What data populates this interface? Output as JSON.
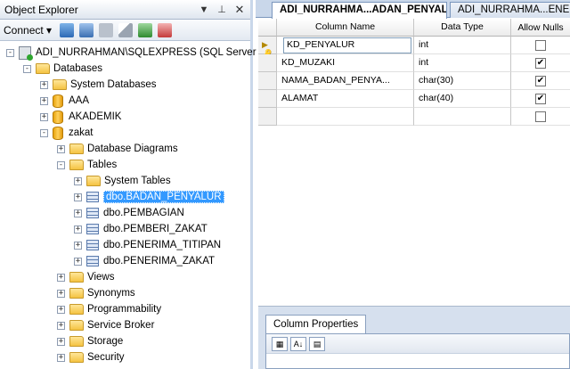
{
  "explorer": {
    "title": "Object Explorer",
    "pin_glyph": "▼",
    "autohide_glyph": "⊥",
    "close_glyph": "✕",
    "connect_label": "Connect ▾",
    "tree": [
      {
        "label": "ADI_NURRAHMAN\\SQLEXPRESS (SQL Server",
        "indent": 0,
        "exp": "-",
        "icon": "server-icon"
      },
      {
        "label": "Databases",
        "indent": 1,
        "exp": "-",
        "icon": "folder-icon"
      },
      {
        "label": "System Databases",
        "indent": 2,
        "exp": "+",
        "icon": "folder-icon"
      },
      {
        "label": "AAA",
        "indent": 2,
        "exp": "+",
        "icon": "database-icon"
      },
      {
        "label": "AKADEMIK",
        "indent": 2,
        "exp": "+",
        "icon": "database-icon"
      },
      {
        "label": "zakat",
        "indent": 2,
        "exp": "-",
        "icon": "database-icon"
      },
      {
        "label": "Database Diagrams",
        "indent": 3,
        "exp": "+",
        "icon": "folder-icon"
      },
      {
        "label": "Tables",
        "indent": 3,
        "exp": "-",
        "icon": "folder-icon"
      },
      {
        "label": "System Tables",
        "indent": 4,
        "exp": "+",
        "icon": "folder-icon"
      },
      {
        "label": "dbo.BADAN_PENYALUR",
        "indent": 4,
        "exp": "+",
        "icon": "table-icon",
        "selected": true
      },
      {
        "label": "dbo.PEMBAGIAN",
        "indent": 4,
        "exp": "+",
        "icon": "table-icon"
      },
      {
        "label": "dbo.PEMBERI_ZAKAT",
        "indent": 4,
        "exp": "+",
        "icon": "table-icon"
      },
      {
        "label": "dbo.PENERIMA_TITIPAN",
        "indent": 4,
        "exp": "+",
        "icon": "table-icon"
      },
      {
        "label": "dbo.PENERIMA_ZAKAT",
        "indent": 4,
        "exp": "+",
        "icon": "table-icon"
      },
      {
        "label": "Views",
        "indent": 3,
        "exp": "+",
        "icon": "folder-icon"
      },
      {
        "label": "Synonyms",
        "indent": 3,
        "exp": "+",
        "icon": "folder-icon"
      },
      {
        "label": "Programmability",
        "indent": 3,
        "exp": "+",
        "icon": "folder-icon"
      },
      {
        "label": "Service Broker",
        "indent": 3,
        "exp": "+",
        "icon": "folder-icon"
      },
      {
        "label": "Storage",
        "indent": 3,
        "exp": "+",
        "icon": "folder-icon"
      },
      {
        "label": "Security",
        "indent": 3,
        "exp": "+",
        "icon": "folder-icon"
      }
    ]
  },
  "tabs": {
    "active": "ADI_NURRAHMA...ADAN_PENYALUR",
    "inactive": "ADI_NURRAHMA...ENE"
  },
  "grid": {
    "headers": {
      "name": "Column Name",
      "type": "Data Type",
      "nulls": "Allow Nulls"
    },
    "rows": [
      {
        "name": "KD_PENYALUR",
        "type": "int",
        "nulls": false,
        "key": true,
        "editing": true
      },
      {
        "name": "KD_MUZAKI",
        "type": "int",
        "nulls": true
      },
      {
        "name": "NAMA_BADAN_PENYA...",
        "type": "char(30)",
        "nulls": true
      },
      {
        "name": "ALAMAT",
        "type": "char(40)",
        "nulls": true
      },
      {
        "name": "",
        "type": "",
        "nulls": false
      }
    ],
    "check_glyph": "✔",
    "key_glyph": "▶🔑"
  },
  "column_properties": {
    "tab_label": "Column Properties",
    "categorized_glyph": "▦",
    "alpha_glyph": "A↓",
    "pages_glyph": "▤"
  }
}
